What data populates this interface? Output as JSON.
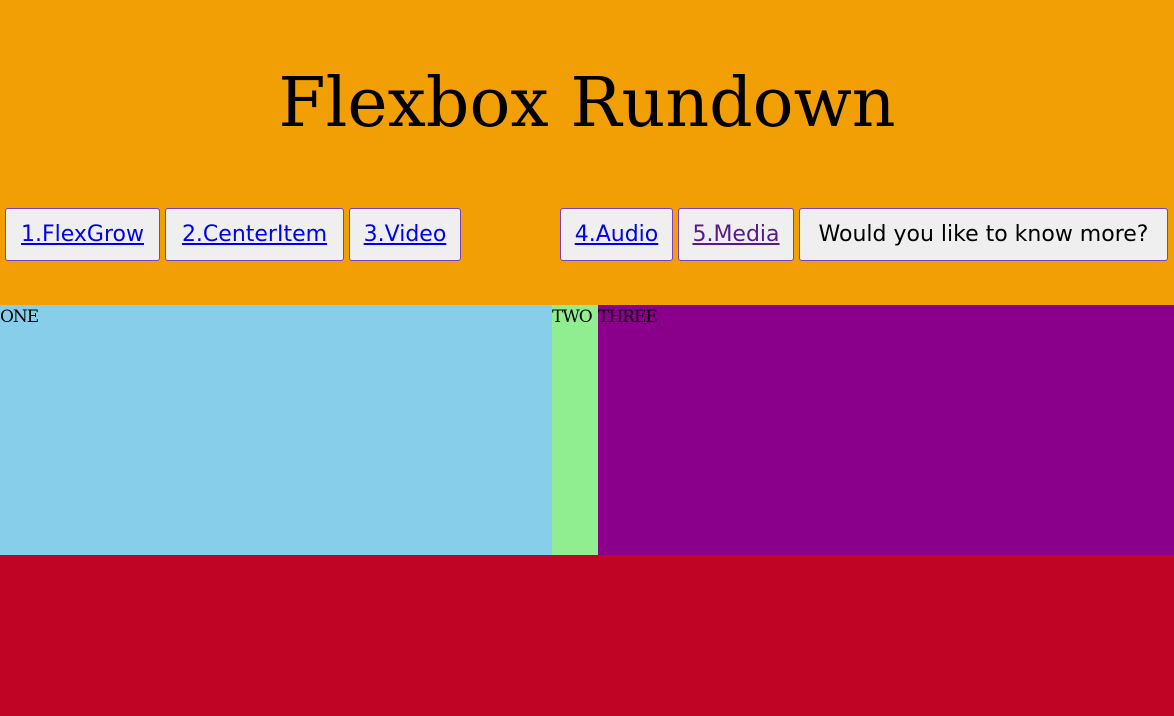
{
  "header": {
    "title": "Flexbox Rundown",
    "background": "#F29F05"
  },
  "nav": {
    "items": [
      {
        "label": "1.FlexGrow",
        "visited": false
      },
      {
        "label": "2.CenterItem",
        "visited": false
      },
      {
        "label": "3.Video",
        "visited": false
      },
      {
        "label": "4.Audio",
        "visited": false
      },
      {
        "label": "5.Media",
        "visited": true
      }
    ],
    "more_button": "Would you like to know more?"
  },
  "boxes": [
    {
      "label": "ONE",
      "color": "#87CEEB"
    },
    {
      "label": "TWO",
      "color": "#90EE90"
    },
    {
      "label": "THREE",
      "color": "#8B008B"
    }
  ],
  "footer": {
    "color": "#BF0426"
  }
}
